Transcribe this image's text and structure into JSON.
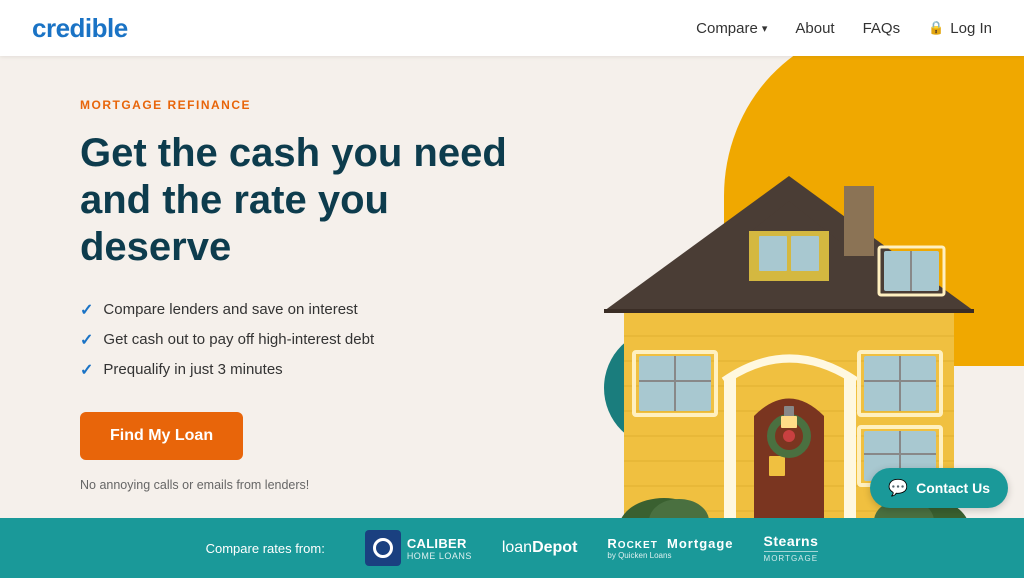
{
  "nav": {
    "logo": "credible",
    "links": [
      {
        "label": "Compare",
        "hasDropdown": true,
        "name": "compare"
      },
      {
        "label": "About",
        "name": "about"
      },
      {
        "label": "FAQs",
        "name": "faqs"
      },
      {
        "label": "Log In",
        "name": "login"
      }
    ]
  },
  "hero": {
    "eyebrow": "MORTGAGE REFINANCE",
    "headline_line1": "Get the cash you need",
    "headline_line2": "and the rate you deserve",
    "checklist": [
      "Compare lenders and save on interest",
      "Get cash out to pay off high-interest debt",
      "Prequalify in just 3 minutes"
    ],
    "cta_label": "Find My Loan",
    "disclaimer": "No annoying calls or emails from lenders!"
  },
  "bottom_bar": {
    "compare_text": "Compare rates from:",
    "lenders": [
      {
        "name": "CALIBER",
        "sub": "HOME LOANS",
        "type": "caliber"
      },
      {
        "name": "loanDepot",
        "type": "loandepot"
      },
      {
        "name": "ROCKET Mortgage",
        "sub": "by Quicken Loans",
        "type": "rocket"
      },
      {
        "name": "Stearns",
        "sub": "MORTGAGE",
        "type": "stearns"
      }
    ]
  },
  "contact": {
    "label": "Contact Us"
  }
}
